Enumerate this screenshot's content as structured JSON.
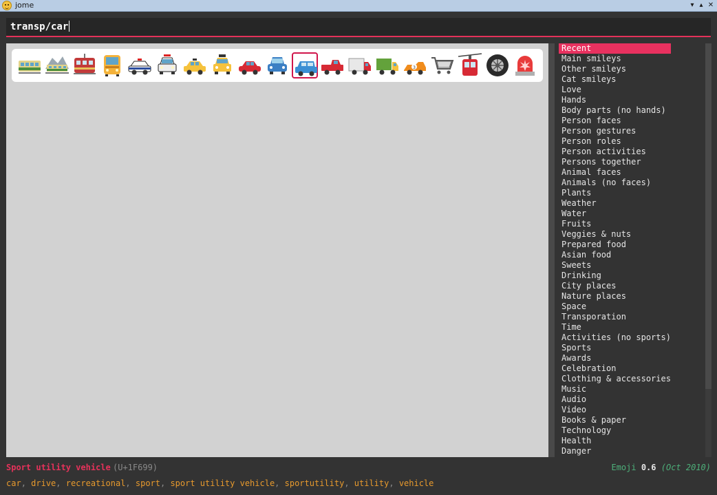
{
  "window": {
    "title": "jome",
    "minimize": "▾",
    "maximize": "▴",
    "close": "✕"
  },
  "search": {
    "value": "transp/car"
  },
  "emojis": [
    {
      "name": "railway-car",
      "selected": false
    },
    {
      "name": "mountain-railway",
      "selected": false
    },
    {
      "name": "tram-car",
      "selected": false
    },
    {
      "name": "bus",
      "selected": false
    },
    {
      "name": "police-car",
      "selected": false
    },
    {
      "name": "oncoming-police-car",
      "selected": false
    },
    {
      "name": "taxi",
      "selected": false
    },
    {
      "name": "oncoming-taxi",
      "selected": false
    },
    {
      "name": "automobile",
      "selected": false
    },
    {
      "name": "oncoming-automobile",
      "selected": false
    },
    {
      "name": "sport-utility-vehicle",
      "selected": true
    },
    {
      "name": "pickup-truck",
      "selected": false
    },
    {
      "name": "delivery-truck",
      "selected": false
    },
    {
      "name": "articulated-lorry",
      "selected": false
    },
    {
      "name": "racing-car",
      "selected": false
    },
    {
      "name": "shopping-cart",
      "selected": false
    },
    {
      "name": "aerial-tramway",
      "selected": false
    },
    {
      "name": "wheel",
      "selected": false
    },
    {
      "name": "police-car-light",
      "selected": false
    }
  ],
  "categories": [
    "Recent",
    "Main smileys",
    "Other smileys",
    "Cat smileys",
    "Love",
    "Hands",
    "Body parts (no hands)",
    "Person faces",
    "Person gestures",
    "Person roles",
    "Person activities",
    "Persons together",
    "Animal faces",
    "Animals (no faces)",
    "Plants",
    "Weather",
    "Water",
    "Fruits",
    "Veggies & nuts",
    "Prepared food",
    "Asian food",
    "Sweets",
    "Drinking",
    "City places",
    "Nature places",
    "Space",
    "Transporation",
    "Time",
    "Activities (no sports)",
    "Sports",
    "Awards",
    "Celebration",
    "Clothing & accessories",
    "Music",
    "Audio",
    "Video",
    "Books & paper",
    "Technology",
    "Health",
    "Danger"
  ],
  "active_category": "Recent",
  "status": {
    "name": "Sport utility vehicle",
    "code": "(U+1F699)",
    "version_label": "Emoji",
    "version": "0.6",
    "date": "(Oct 2010)",
    "keywords": [
      "car",
      "drive",
      "recreational",
      "sport",
      "sport utility vehicle",
      "sportutility",
      "utility",
      "vehicle"
    ]
  },
  "colors": {
    "accent": "#e5325a",
    "keyword": "#e89a2d",
    "version": "#4db07a"
  }
}
